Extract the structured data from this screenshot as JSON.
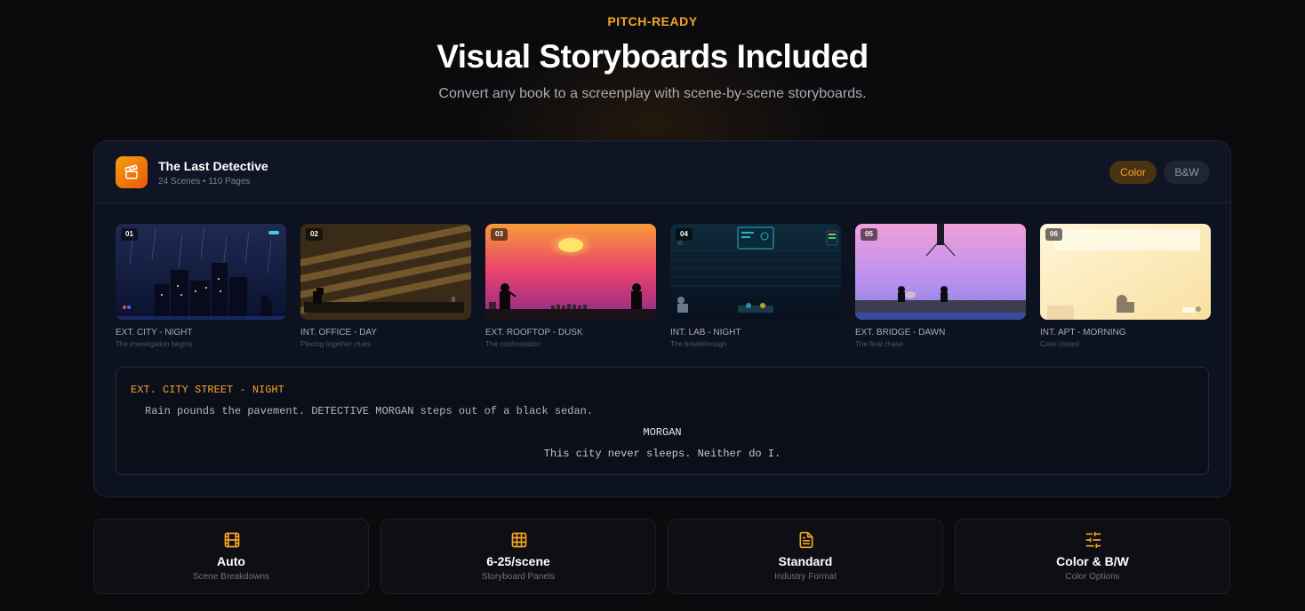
{
  "hero": {
    "eyebrow": "PITCH-READY",
    "title": "Visual Storyboards Included",
    "subtitle": "Convert any book to a screenplay with scene-by-scene storyboards."
  },
  "project": {
    "icon": "clapperboard-icon",
    "title": "The Last Detective",
    "meta": "24 Scenes • 110 Pages",
    "toggles": {
      "color": "Color",
      "bw": "B&W",
      "active": "color"
    }
  },
  "scenes": [
    {
      "number": "01",
      "title": "EXT. CITY - NIGHT",
      "subtitle": "The investigation begins"
    },
    {
      "number": "02",
      "title": "INT. OFFICE - DAY",
      "subtitle": "Piecing together clues"
    },
    {
      "number": "03",
      "title": "EXT. ROOFTOP - DUSK",
      "subtitle": "The confrontation"
    },
    {
      "number": "04",
      "title": "INT. LAB - NIGHT",
      "subtitle": "The breakthrough"
    },
    {
      "number": "05",
      "title": "EXT. BRIDGE - DAWN",
      "subtitle": "The final chase"
    },
    {
      "number": "06",
      "title": "INT. APT - MORNING",
      "subtitle": "Case closed"
    }
  ],
  "script": {
    "slugline": "EXT. CITY STREET - NIGHT",
    "action": "Rain pounds the pavement. DETECTIVE MORGAN steps out of a black sedan.",
    "character": "MORGAN",
    "dialogue": "This city never sleeps. Neither do I."
  },
  "features": [
    {
      "icon": "film-icon",
      "value": "Auto",
      "label": "Scene Breakdowns"
    },
    {
      "icon": "grid-icon",
      "value": "6-25/scene",
      "label": "Storyboard Panels"
    },
    {
      "icon": "document-icon",
      "value": "Standard",
      "label": "Industry Format"
    },
    {
      "icon": "sliders-icon",
      "value": "Color & B/W",
      "label": "Color Options"
    }
  ],
  "colors": {
    "accent": "#f5a524",
    "background": "#0b0b0e",
    "card": "#0d1220"
  }
}
